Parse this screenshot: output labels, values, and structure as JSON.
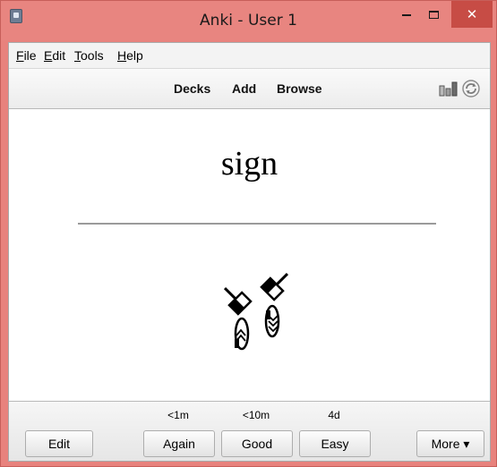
{
  "window": {
    "title": "Anki - User 1",
    "icons": {
      "app": "anki-app-icon",
      "minimize": "minimize-icon",
      "maximize": "maximize-icon",
      "close": "close-icon"
    },
    "close_glyph": "✕"
  },
  "menu": {
    "file": {
      "mnemonic": "F",
      "rest": "ile"
    },
    "edit": {
      "mnemonic": "E",
      "rest": "dit"
    },
    "tools": {
      "mnemonic": "T",
      "rest": "ools"
    },
    "help": {
      "mnemonic": "H",
      "rest": "elp"
    }
  },
  "toolbar": {
    "decks": "Decks",
    "add": "Add",
    "browse": "Browse",
    "icons": {
      "stats": "stats-icon",
      "sync": "sync-icon"
    }
  },
  "card": {
    "front": "sign",
    "image_icon": "signwriting-sign-glyph"
  },
  "answer": {
    "edit": "Edit",
    "again": {
      "interval": "<1m",
      "label": "Again"
    },
    "good": {
      "interval": "<10m",
      "label": "Good"
    },
    "easy": {
      "interval": "4d",
      "label": "Easy"
    },
    "more": "More ▾"
  },
  "colors": {
    "titlebar": "#e88580",
    "close_button": "#c74c45",
    "window_border": "#c75f5a"
  }
}
